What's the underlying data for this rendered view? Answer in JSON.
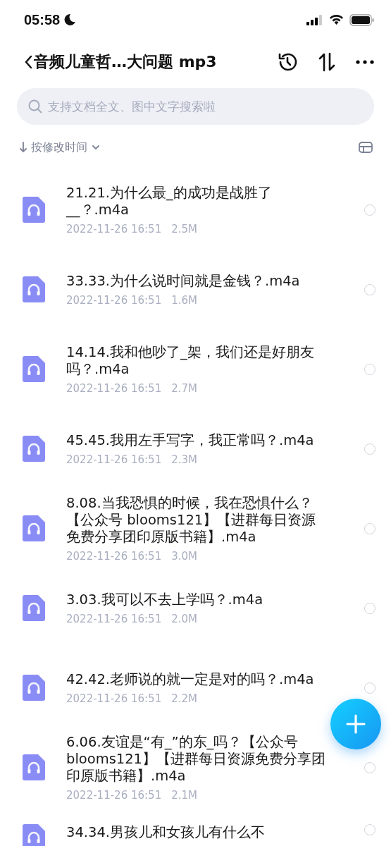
{
  "status_bar": {
    "time": "05:58"
  },
  "nav": {
    "title": "音频儿童哲…大问题 mp3"
  },
  "search": {
    "placeholder": "支持文档全文、图中文字搜索啦"
  },
  "sort": {
    "label": "按修改时间"
  },
  "files": [
    {
      "name": "21.21.为什么最_的成功是战胜了__？.m4a",
      "date": "2022-11-26 16:51",
      "size": "2.5M",
      "selected": false
    },
    {
      "name": "33.33.为什么说时间就是金钱？.m4a",
      "date": "2022-11-26 16:51",
      "size": "1.6M",
      "selected": false
    },
    {
      "name": "14.14.我和他吵了_架，我们还是好朋友吗？.m4a",
      "date": "2022-11-26 16:51",
      "size": "2.7M",
      "selected": false
    },
    {
      "name": "45.45.我用左手写字，我正常吗？.m4a",
      "date": "2022-11-26 16:51",
      "size": "2.3M",
      "selected": false
    },
    {
      "name": "8.08.当我恐惧的时候，我在恐惧什么？【公众号 blooms121】【进群每日资源免费分享团印原版书籍】.m4a",
      "date": "2022-11-26 16:51",
      "size": "3.0M",
      "selected": false
    },
    {
      "name": "3.03.我可以不去上学吗？.m4a",
      "date": "2022-11-26 16:51",
      "size": "2.0M",
      "selected": false
    },
    {
      "name": "42.42.老师说的就一定是对的吗？.m4a",
      "date": "2022-11-26 16:51",
      "size": "2.2M",
      "selected": false
    },
    {
      "name": "6.06.友谊是“有_”的东_吗？【公众号 blooms121】【进群每日资源免费分享团印原版书籍】.m4a",
      "date": "2022-11-26 16:51",
      "size": "2.1M",
      "selected": false
    },
    {
      "name": "34.34.男孩儿和女孩儿有什么不",
      "selected": false
    }
  ]
}
